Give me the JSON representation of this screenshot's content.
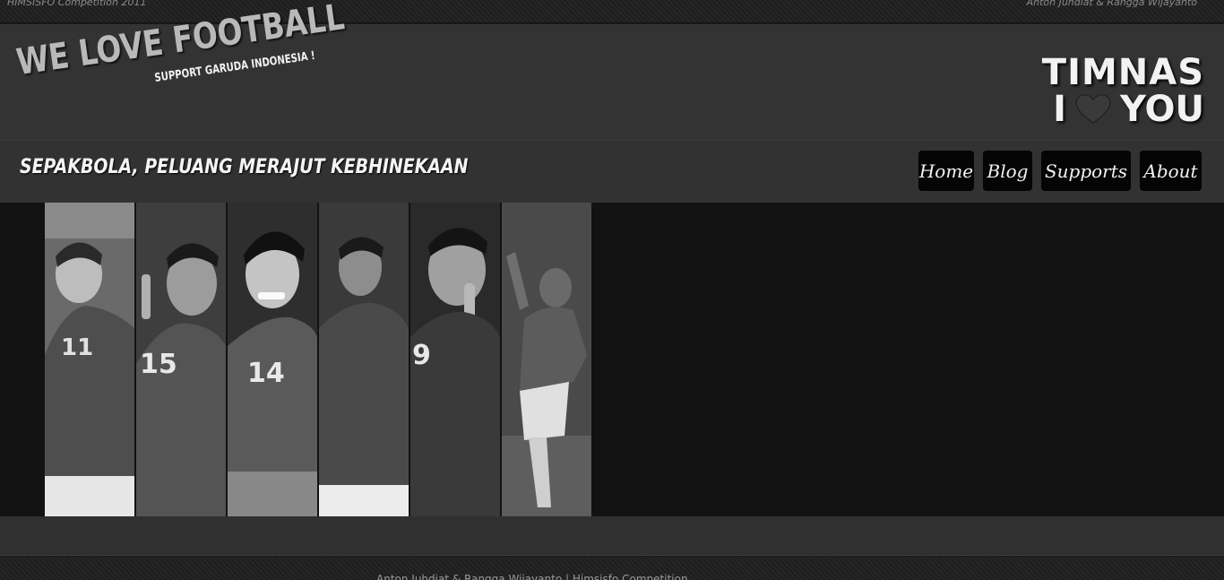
{
  "topbar": {
    "left_text": "HIMSISFO Competition 2011",
    "right_text": "Anton Juhdiat & Rangga Wijayanto"
  },
  "logo": {
    "main": "WE LOVE FOOTBALL",
    "sub": "SUPPORT GARUDA INDONESIA !"
  },
  "badge": {
    "line1": "TIMNAS",
    "line2_left": "I",
    "line2_right": "YOU",
    "heart_icon": "heart-icon"
  },
  "tagline": "SEPAKBOLA, PELUANG MERAJUT KEBHINEKAAN",
  "nav": {
    "items": [
      {
        "label": "Home"
      },
      {
        "label": "Blog"
      },
      {
        "label": "Supports"
      },
      {
        "label": "About"
      }
    ]
  },
  "banner": {
    "players": [
      {
        "number": "11"
      },
      {
        "number": "15"
      },
      {
        "number": "14"
      },
      {
        "number": ""
      },
      {
        "number": "9"
      },
      {
        "number": ""
      }
    ]
  },
  "footer": {
    "text": "Anton Juhdiat & Rangga Wijayanto | Himsisfo Competition"
  },
  "colors": {
    "header_bg": "#333333",
    "banner_bg": "#121212",
    "nav_button_bg": "#050505",
    "text_light": "#f2f2f2"
  }
}
